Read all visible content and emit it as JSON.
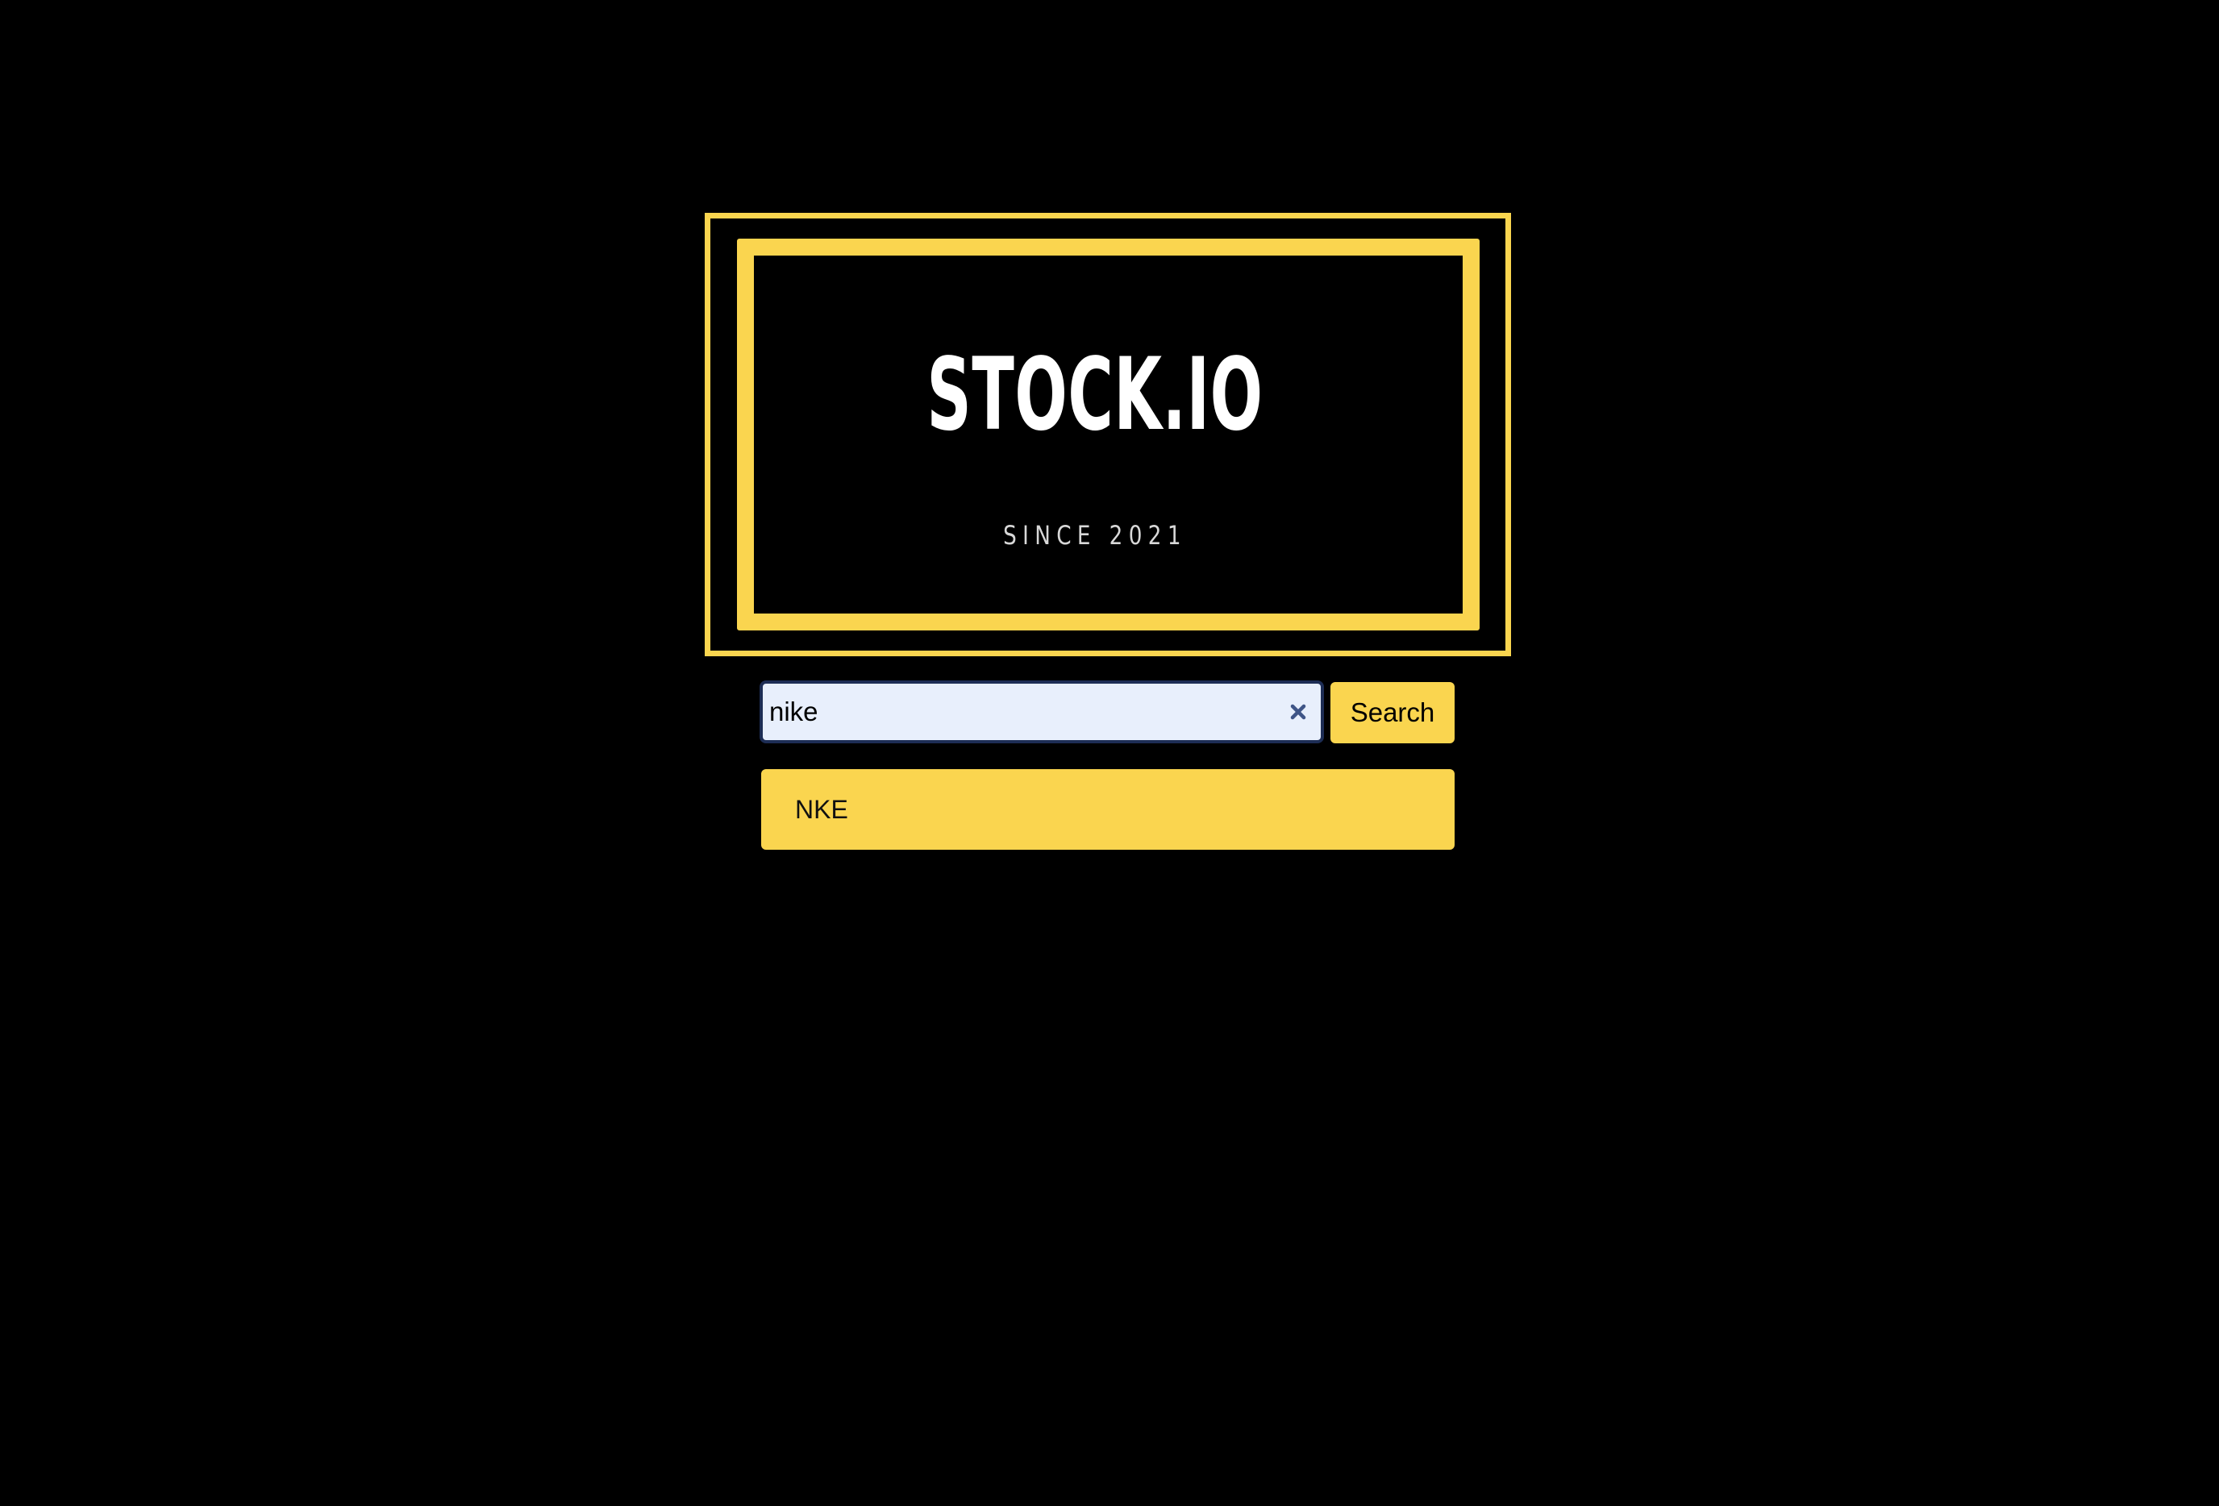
{
  "logo": {
    "title": "STOCK.IO",
    "subtitle": "SINCE 2021"
  },
  "search": {
    "value": "nike",
    "clear_icon": "close-icon",
    "button_label": "Search"
  },
  "results": [
    {
      "label": "NKE"
    }
  ],
  "colors": {
    "background": "#000000",
    "accent": "#fad54f",
    "input_background": "#e8effc",
    "input_border": "#1d2d55"
  }
}
